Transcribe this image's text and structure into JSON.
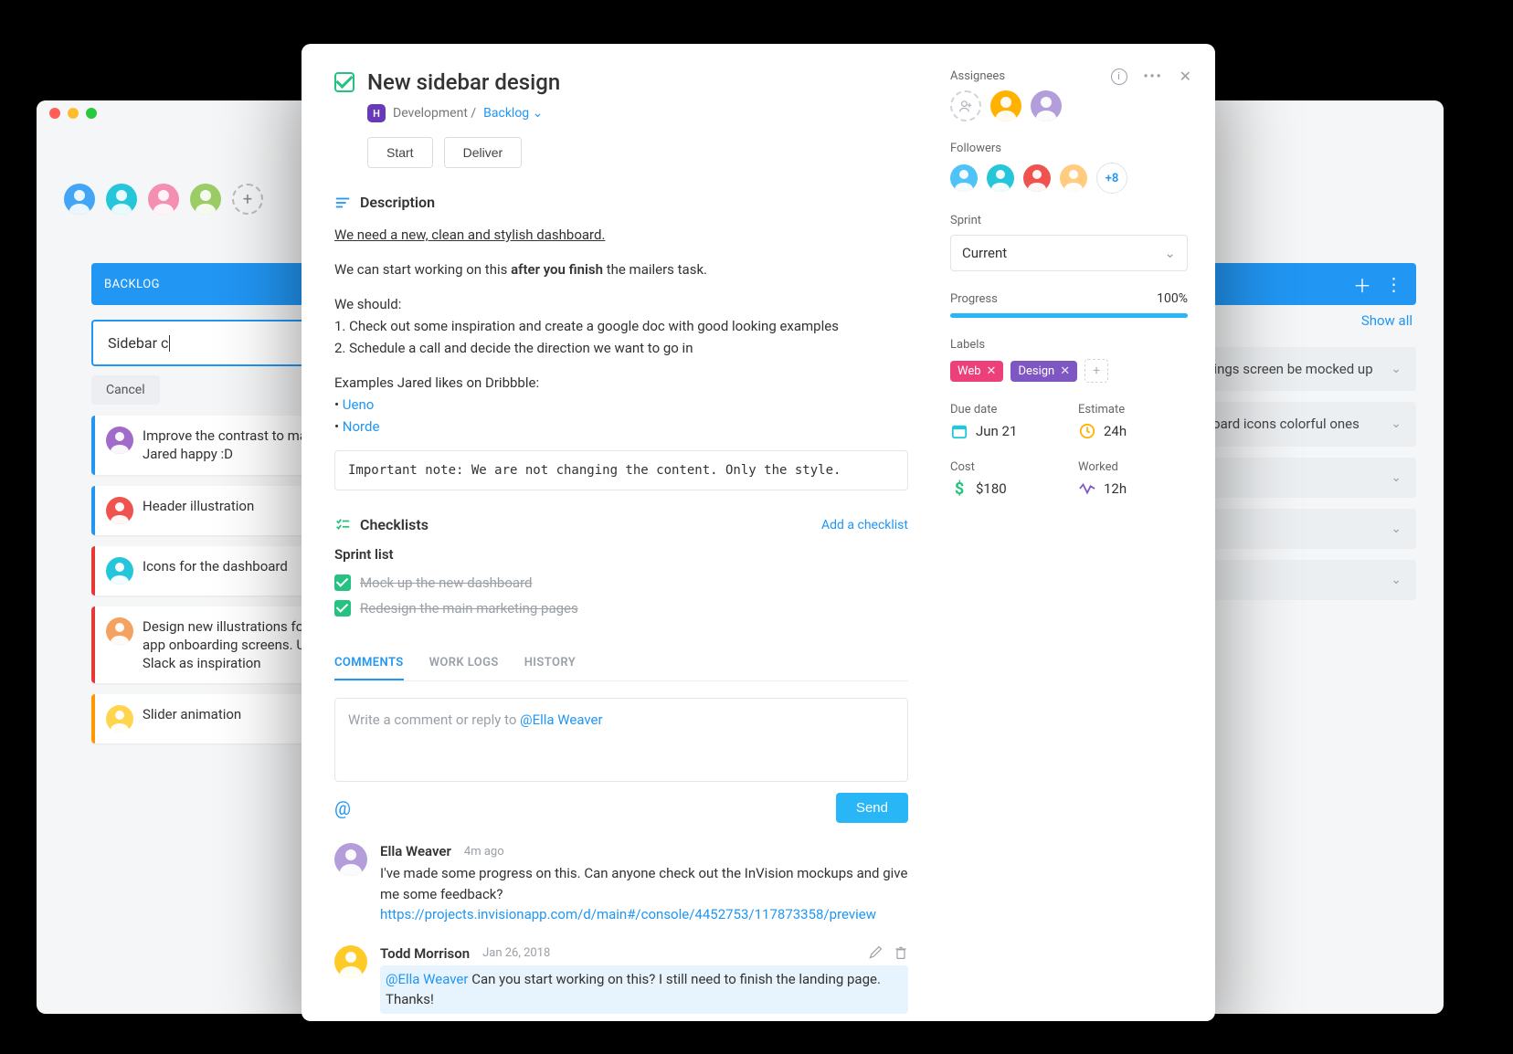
{
  "bg": {
    "backlog_label": "BACKLOG",
    "new_card_value": "Sidebar c",
    "cancel": "Cancel",
    "cards": [
      {
        "text": "Improve the contrast to make Jared happy :D",
        "stripe": "stripe-blue",
        "avatar": "#a06bc9"
      },
      {
        "text": "Header illustration",
        "stripe": "stripe-blue",
        "avatar": "#ef5350"
      },
      {
        "text": "Icons for the dashboard",
        "stripe": "stripe-red",
        "avatar": "#26c6da"
      },
      {
        "text": "Design new illustrations for the app onboarding screens. Use Slack as inspiration",
        "stripe": "stripe-red",
        "avatar": "#f4a261"
      },
      {
        "text": "Slider animation",
        "stripe": "stripe-orange",
        "avatar": "#ffd54f"
      }
    ],
    "right_header_add": "+",
    "show_all": "Show all",
    "right_cards": [
      "…nt settings screen … be mocked up",
      "…dashboard icons … colorful ones",
      "",
      "",
      ""
    ]
  },
  "modal": {
    "title": "New sidebar design",
    "crumb_pill": "H",
    "crumb_dev": "Development /",
    "crumb_link": "Backlog",
    "actions": {
      "start": "Start",
      "deliver": "Deliver"
    },
    "top_icons": {
      "info": "ⓘ",
      "more": "•••",
      "close": "✕"
    },
    "description": {
      "label": "Description",
      "line1": "We need a new, clean and stylish dashboard.",
      "line2_a": "We can start working on this ",
      "line2_b": "after you finish",
      "line2_c": " the mailers task.",
      "should": "We should:",
      "step1": "1. Check out some inspiration and create a google doc with good looking examples",
      "step2": "2. Schedule a call and decide the direction we want to go in",
      "examples": "Examples Jared likes on Dribbble:",
      "link1": "Ueno",
      "link2": "Norde",
      "note": "Important note: We are not changing the content. Only the style."
    },
    "checklists": {
      "label": "Checklists",
      "add": "Add a checklist",
      "sprint_title": "Sprint list",
      "items": [
        "Mock up the new dashboard",
        "Redesign the main marketing pages"
      ]
    },
    "tabs": {
      "comments": "COMMENTS",
      "worklogs": "WORK LOGS",
      "history": "HISTORY"
    },
    "comment_box": {
      "prefix": "Write a comment or reply to ",
      "mention": "@Ella Weaver"
    },
    "send": "Send",
    "comments": [
      {
        "author": "Ella Weaver",
        "time": "4m ago",
        "text": "I've made some progress on this. Can anyone check out the InVision mockups and give me some feedback?",
        "link": "https://projects.invisionapp.com/d/main#/console/4452753/117873358/preview",
        "avatar": "#b39ddb"
      },
      {
        "author": "Todd Morrison",
        "time": "Jan 26, 2018",
        "mention": "@Ella Weaver",
        "text": " Can you start working on this? I still need to finish the landing page. Thanks!",
        "avatar": "#ffca28",
        "highlighted": true
      }
    ]
  },
  "meta": {
    "assignees_label": "Assignees",
    "followers_label": "Followers",
    "followers_more": "+8",
    "sprint_label": "Sprint",
    "sprint_value": "Current",
    "progress_label": "Progress",
    "progress_value": "100%",
    "labels_label": "Labels",
    "labels": [
      {
        "name": "Web",
        "color": "#ec407a"
      },
      {
        "name": "Design",
        "color": "#7e57c2"
      }
    ],
    "due_label": "Due date",
    "due_value": "Jun 21",
    "estimate_label": "Estimate",
    "estimate_value": "24h",
    "cost_label": "Cost",
    "cost_value": "$180",
    "worked_label": "Worked",
    "worked_value": "12h"
  }
}
